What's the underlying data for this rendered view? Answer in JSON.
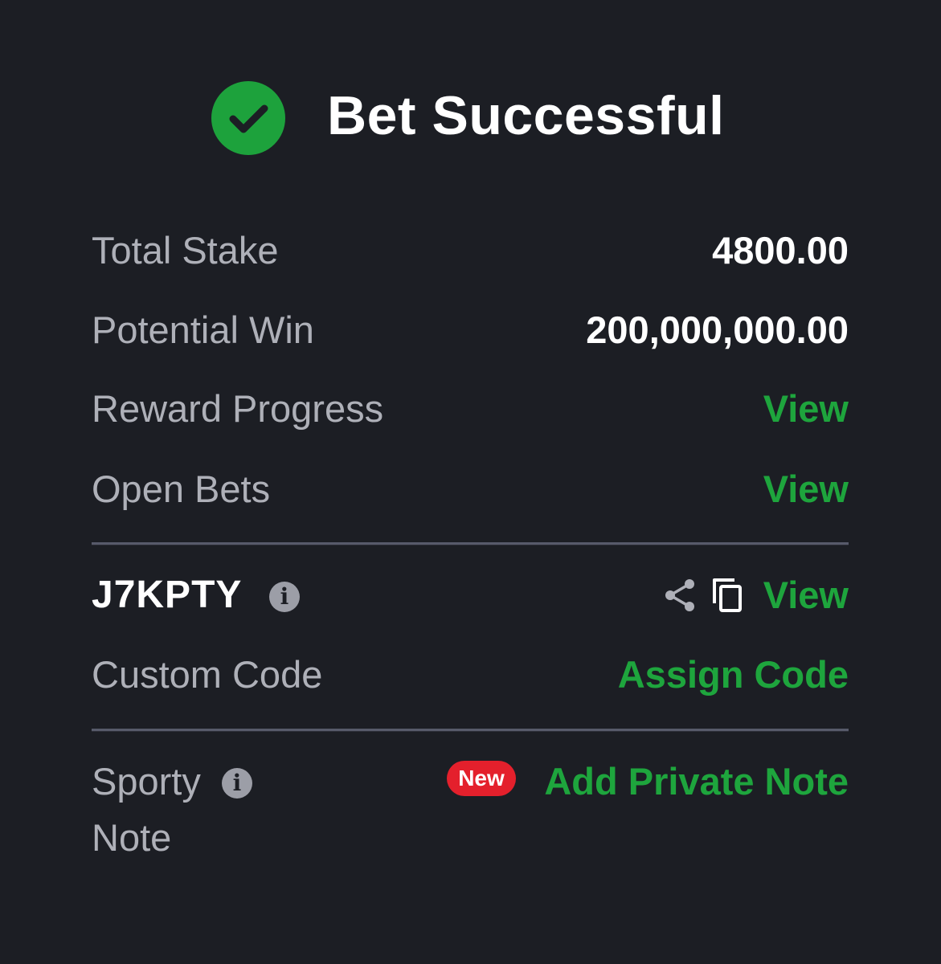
{
  "header": {
    "title": "Bet Successful",
    "icon": "check-circle-icon",
    "icon_color": "#1da23c"
  },
  "details": {
    "total_stake": {
      "label": "Total Stake",
      "value": "4800.00"
    },
    "potential_win": {
      "label": "Potential Win",
      "value": "200,000,000.00"
    },
    "reward_progress": {
      "label": "Reward Progress",
      "action": "View"
    },
    "open_bets": {
      "label": "Open Bets",
      "action": "View"
    }
  },
  "booking": {
    "code": "J7KPTY",
    "info_icon": "info-icon",
    "info_glyph": "i",
    "share_icon": "share-icon",
    "copy_icon": "copy-icon",
    "action": "View"
  },
  "custom_code": {
    "label": "Custom Code",
    "action": "Assign Code"
  },
  "sporty_note": {
    "label_line1": "Sporty",
    "label_line2": "Note",
    "info_glyph": "i",
    "badge": "New",
    "action": "Add Private Note"
  },
  "colors": {
    "background": "#1c1e24",
    "accent_green": "#1ea53d",
    "label_grey": "#aeb0b8",
    "badge_red": "#e4202c"
  }
}
